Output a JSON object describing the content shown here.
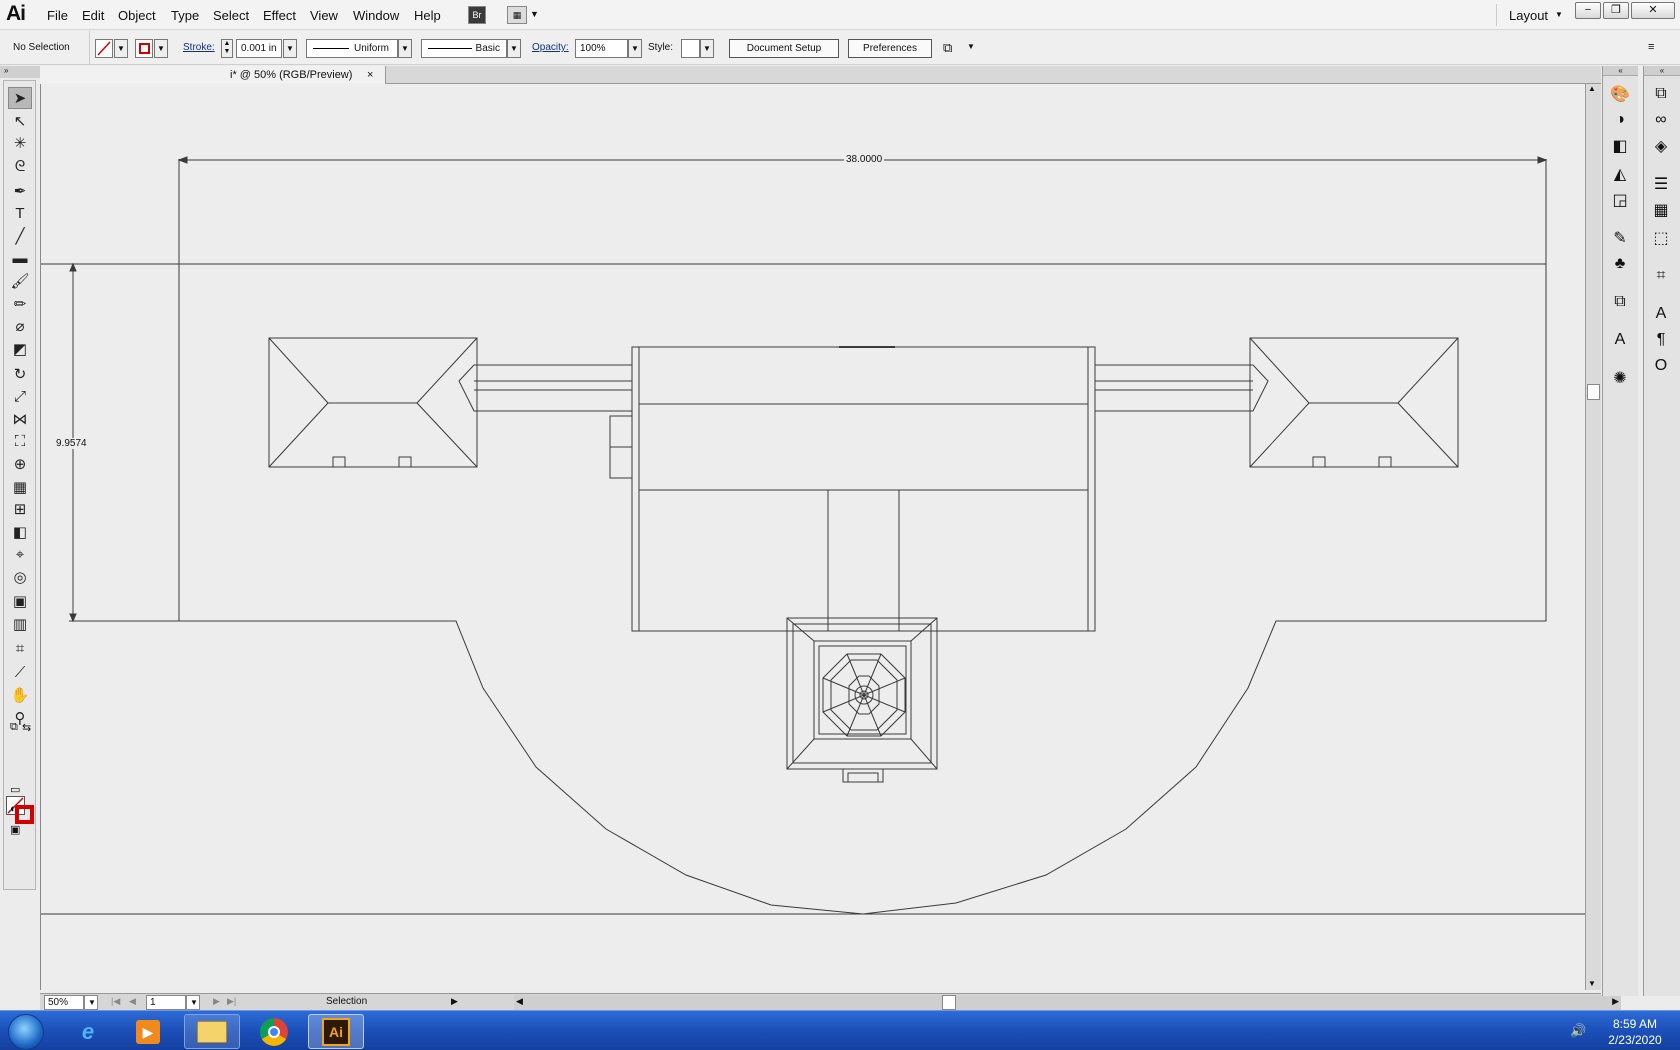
{
  "app": {
    "logo": "Ai",
    "menus": [
      "File",
      "Edit",
      "Object",
      "Type",
      "Select",
      "Effect",
      "View",
      "Window",
      "Help"
    ],
    "bridge_label": "Br",
    "workspace_label": "Layout",
    "window_buttons": [
      "−",
      "❐",
      "✕"
    ]
  },
  "control_bar": {
    "selection_status": "No Selection",
    "stroke_label": "Stroke:",
    "stroke_weight": "0.001 in",
    "profile": "Uniform",
    "brush": "Basic",
    "opacity_label": "Opacity:",
    "opacity_value": "100%",
    "style_label": "Style:",
    "document_setup": "Document Setup",
    "preferences": "Preferences"
  },
  "document": {
    "tab_title": "i* @ 50% (RGB/Preview)",
    "close_glyph": "×",
    "dimension_width": "38.0000",
    "dimension_height": "9.9574"
  },
  "status_bar": {
    "zoom": "50%",
    "artboard": "1",
    "tool_status": "Selection"
  },
  "tools": [
    {
      "name": "selection-tool",
      "glyph": "➤"
    },
    {
      "name": "direct-selection-tool",
      "glyph": "↖"
    },
    {
      "name": "magic-wand-tool",
      "glyph": "✳"
    },
    {
      "name": "lasso-tool",
      "glyph": "ᘓ"
    },
    {
      "name": "pen-tool",
      "glyph": "✒"
    },
    {
      "name": "type-tool",
      "glyph": "T"
    },
    {
      "name": "line-tool",
      "glyph": "╱"
    },
    {
      "name": "rectangle-tool",
      "glyph": "▬"
    },
    {
      "name": "paintbrush-tool",
      "glyph": "🖌"
    },
    {
      "name": "pencil-tool",
      "glyph": "✏"
    },
    {
      "name": "blob-brush-tool",
      "glyph": "⌀"
    },
    {
      "name": "eraser-tool",
      "glyph": "◩"
    },
    {
      "name": "rotate-tool",
      "glyph": "↻"
    },
    {
      "name": "scale-tool",
      "glyph": "⤢"
    },
    {
      "name": "width-tool",
      "glyph": "⋈"
    },
    {
      "name": "free-transform-tool",
      "glyph": "⛶"
    },
    {
      "name": "shape-builder-tool",
      "glyph": "⊕"
    },
    {
      "name": "perspective-grid-tool",
      "glyph": "▦"
    },
    {
      "name": "mesh-tool",
      "glyph": "⊞"
    },
    {
      "name": "gradient-tool",
      "glyph": "◧"
    },
    {
      "name": "eyedropper-tool",
      "glyph": "⌖"
    },
    {
      "name": "blend-tool",
      "glyph": "◎"
    },
    {
      "name": "symbol-sprayer-tool",
      "glyph": "▣"
    },
    {
      "name": "column-graph-tool",
      "glyph": "▥"
    },
    {
      "name": "artboard-tool",
      "glyph": "⌗"
    },
    {
      "name": "slice-tool",
      "glyph": "⟋"
    },
    {
      "name": "hand-tool",
      "glyph": "✋"
    },
    {
      "name": "zoom-tool",
      "glyph": "⚲"
    }
  ],
  "panels_left_column": [
    "color-icon",
    "color-guide-icon",
    "gradient-icon",
    "transparency-icon",
    "appearance-icon",
    "brushes-icon",
    "symbols-icon",
    "graphic-styles-icon",
    "character-icon",
    "stroke-panel-icon"
  ],
  "panels_right_column": [
    "artboards-icon",
    "links-icon",
    "layers-icon",
    "align-icon",
    "swatches-icon",
    "transform-icon",
    "pathfinder-icon",
    "character-style-icon",
    "paragraph-icon",
    "opentype-icon"
  ],
  "taskbar": {
    "clock_time": "8:59 AM",
    "clock_date": "2/23/2020",
    "ai_button": "Ai"
  },
  "colors": {
    "canvas": "#ededed",
    "line": "#3a3a3a",
    "taskbar": "#1c50b8",
    "ai_accent": "#f7a11a"
  }
}
